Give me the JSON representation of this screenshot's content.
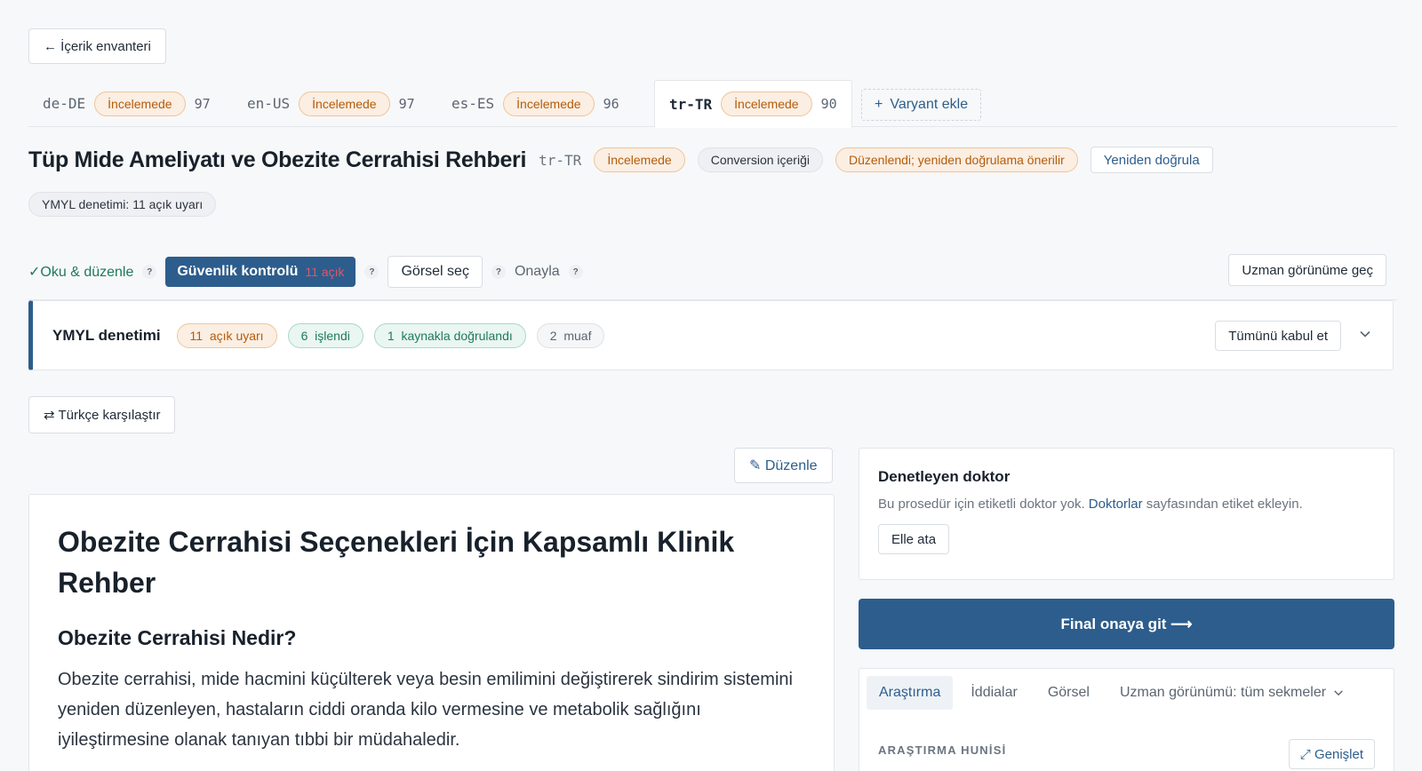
{
  "back_label": "← İçerik envanteri",
  "tabs": [
    {
      "code": "de-DE",
      "status": "İncelemede",
      "score": "97"
    },
    {
      "code": "en-US",
      "status": "İncelemede",
      "score": "97"
    },
    {
      "code": "es-ES",
      "status": "İncelemede",
      "score": "96"
    },
    {
      "code": "tr-TR",
      "status": "İncelemede",
      "score": "90"
    }
  ],
  "add_variant": {
    "icon": "+",
    "label": "Varyant ekle"
  },
  "header": {
    "title": "Tüp Mide Ameliyatı ve Obezite Cerrahisi Rehberi",
    "locale": "tr-TR",
    "status": "İncelemede",
    "content_type": "Conversion içeriği",
    "edit_note": "Düzenlendi; yeniden doğrulama önerilir",
    "reverify": "Yeniden doğrula",
    "ymyl_chip": "YMYL denetimi: 11 açık uyarı"
  },
  "steps": {
    "read_edit": "✓Oku & düzenle",
    "safety": "Güvenlik kontrolü",
    "safety_open": "11 açık",
    "image": "Görsel seç",
    "approve": "Onayla",
    "help": "?",
    "expert_view": "Uzman görünüme geç"
  },
  "ymyl_panel": {
    "heading": "YMYL denetimi",
    "open": {
      "count": "11",
      "label": "açık uyarı"
    },
    "handled": {
      "count": "6",
      "label": "işlendi"
    },
    "verified": {
      "count": "1",
      "label": "kaynakla doğrulandı"
    },
    "exempt": {
      "count": "2",
      "label": "muaf"
    },
    "accept_all": "Tümünü kabul et"
  },
  "compare_label": "⇄ Türkçe karşılaştır",
  "edit_label": "✎ Düzenle",
  "article": {
    "h1": "Obezite Cerrahisi Seçenekleri İçin Kapsamlı Klinik Rehber",
    "h2": "Obezite Cerrahisi Nedir?",
    "p": "Obezite cerrahisi, mide hacmini küçülterek veya besin emilimini değiştirerek sindirim sistemini yeniden düzenleyen, hastaların ciddi oranda kilo vermesine ve metabolik sağlığını iyileştirmesine olanak tanıyan tıbbi bir müdahaledir."
  },
  "doctor": {
    "heading": "Denetleyen doktor",
    "note_before": "Bu prosedür için etiketli doktor yok. ",
    "note_link": "Doktorlar",
    "note_after": " sayfasından etiket ekleyin.",
    "assign": "Elle ata"
  },
  "final_label": "Final onaya git ⟶",
  "research": {
    "tabs": [
      "Araştırma",
      "İddialar",
      "Görsel"
    ],
    "expert_tab": "Uzman görünümü: tüm sekmeler",
    "section_label": "ARAŞTIRMA HUNİSİ",
    "expand": "⤢ Genişlet"
  },
  "colors": {
    "accent": "#2d5d8c",
    "warning": "#b45c0a",
    "success": "#1f7a5a",
    "danger": "#e0566b"
  }
}
